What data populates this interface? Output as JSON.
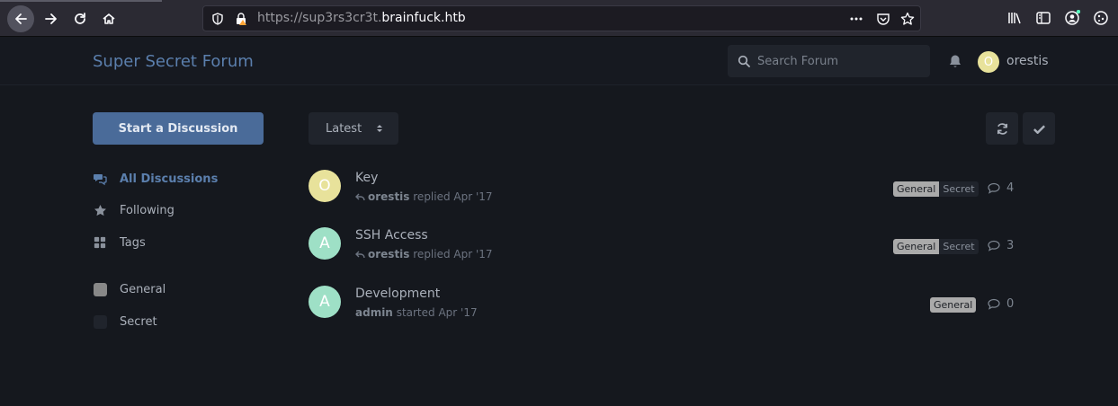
{
  "browser": {
    "url_prefix": "https://sup3rs3cr3t.",
    "url_host": "brainfuck.htb"
  },
  "header": {
    "forum_title": "Super Secret Forum",
    "search_placeholder": "Search Forum",
    "user_initial": "O",
    "user_name": "orestis"
  },
  "sidebar": {
    "start_label": "Start a Discussion",
    "items": [
      {
        "label": "All Discussions",
        "icon": "comments-icon"
      },
      {
        "label": "Following",
        "icon": "star-icon"
      },
      {
        "label": "Tags",
        "icon": "th-large-icon"
      }
    ],
    "tags": [
      {
        "label": "General",
        "color": "#888888"
      },
      {
        "label": "Secret",
        "color": "#20242c"
      }
    ]
  },
  "toolbar": {
    "sort_label": "Latest"
  },
  "discussions": [
    {
      "initial": "O",
      "avatar_color": "#e8e29b",
      "title": "Key",
      "user": "orestis",
      "action": "replied Apr '17",
      "tags": [
        "General",
        "Secret"
      ],
      "replies": "4"
    },
    {
      "initial": "A",
      "avatar_color": "#9ee0c6",
      "title": "SSH Access",
      "user": "orestis",
      "action": "replied Apr '17",
      "tags": [
        "General",
        "Secret"
      ],
      "replies": "3"
    },
    {
      "initial": "A",
      "avatar_color": "#9ee0c6",
      "title": "Development",
      "user": "admin",
      "action": "started Apr '17",
      "tags": [
        "General"
      ],
      "replies": "0"
    }
  ],
  "colors": {
    "accent": "#5b7fad",
    "primary_button": "#4a6b99",
    "background": "#15181e"
  }
}
